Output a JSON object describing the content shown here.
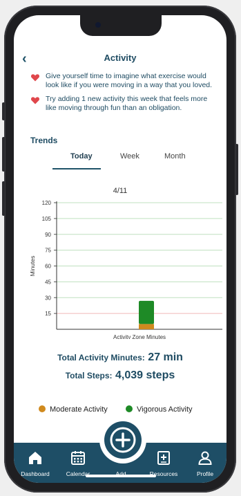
{
  "header": {
    "back_glyph": "‹",
    "title": "Activity"
  },
  "tips": [
    {
      "icon": "heart-icon",
      "text": "Give yourself time to imagine what exercise would look like if you were moving in a way that you loved."
    },
    {
      "icon": "heart-icon",
      "text": "Try adding 1 new activity this week that feels more like moving through fun than an obligation."
    }
  ],
  "trends": {
    "label": "Trends",
    "tabs": [
      {
        "label": "Today",
        "active": true
      },
      {
        "label": "Week",
        "active": false
      },
      {
        "label": "Month",
        "active": false
      }
    ],
    "date": "4/11"
  },
  "chart_data": {
    "type": "bar",
    "ylabel": "Minutes",
    "xlabel": "Activity Zone Minutes",
    "yticks": [
      15,
      30,
      45,
      60,
      75,
      90,
      105,
      120
    ],
    "ylim": [
      0,
      120
    ],
    "categories": [
      "4/11"
    ],
    "series": [
      {
        "name": "Moderate Activity",
        "values": [
          5
        ],
        "color": "#d08a1e"
      },
      {
        "name": "Vigorous Activity",
        "values": [
          22
        ],
        "color": "#1e8a26"
      }
    ],
    "stacked": true,
    "grid": true
  },
  "totals": {
    "activity_label": "Total Activity Minutes:",
    "activity_value": "27 min",
    "steps_label": "Total Steps:",
    "steps_value": "4,039 steps"
  },
  "legend": [
    {
      "label": "Moderate Activity",
      "color": "#d08a1e"
    },
    {
      "label": "Vigorous Activity",
      "color": "#1e8a26"
    }
  ],
  "nav": [
    {
      "label": "Dashboard",
      "icon": "home-icon"
    },
    {
      "label": "Calendar",
      "icon": "calendar-icon"
    },
    {
      "label": "Add",
      "icon": "plus-icon"
    },
    {
      "label": "Resources",
      "icon": "resources-icon"
    },
    {
      "label": "Profile",
      "icon": "profile-icon"
    }
  ],
  "colors": {
    "brand": "#1e4e66",
    "heart": "#e0474c",
    "accent_text": "#1e4b62"
  }
}
